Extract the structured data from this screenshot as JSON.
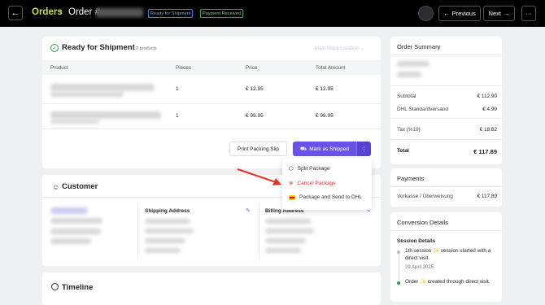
{
  "header": {
    "back_label": "←",
    "breadcrumb_root": "Orders",
    "breadcrumb_sep": "›",
    "order_prefix": "Order #",
    "badge_shipment": "Ready for Shipment",
    "badge_payment": "Payment Received",
    "prev_label": "Previous",
    "next_label": "Next",
    "more_label": "···"
  },
  "shipment": {
    "title": "Ready for Shipment",
    "subtitle": "2 products",
    "location": "Main Stock Location",
    "columns": {
      "product": "Product",
      "pieces": "Pieces",
      "price": "Price",
      "total": "Total Amount"
    },
    "rows": [
      {
        "pieces": "1",
        "price": "€ 12.95",
        "total": "€ 12.95"
      },
      {
        "pieces": "1",
        "price": "€ 99.95",
        "total": "€ 99.95"
      }
    ],
    "print_label": "Print Packing Slip",
    "ship_label": "Mark as Shipped",
    "ship_more": "⋮"
  },
  "dropdown": {
    "split": "Split Package",
    "cancel": "Cancel Package",
    "dhl": "Package and Send to DHL"
  },
  "customer": {
    "title": "Customer",
    "shipping_label": "Shipping Address",
    "billing_label": "Billing Address"
  },
  "timeline": {
    "title": "Timeline"
  },
  "summary": {
    "title": "Order Summary",
    "subtotal_label": "Subtotal",
    "subtotal": "€ 112.90",
    "shipping_label": "DHL Standardversand",
    "shipping": "€ 4.99",
    "tax_label": "Tax (%19)",
    "tax": "€ 18.82",
    "total_label": "Total",
    "total": "€ 117.89"
  },
  "payments": {
    "title": "Payments",
    "method": "Vorkasse / Überweisung",
    "amount": "€ 117.89"
  },
  "conversion": {
    "title": "Conversion Details",
    "subtitle": "Session Details",
    "items": [
      {
        "text": "1th session ✨ session started with a direct visit.",
        "date": "29 April 2025"
      },
      {
        "text": "Order ✨ created through direct visit."
      }
    ]
  },
  "colors": {
    "accent": "#6952e8",
    "brand_green": "#c7dc4c",
    "danger": "#e0393e",
    "success": "#25a244"
  }
}
